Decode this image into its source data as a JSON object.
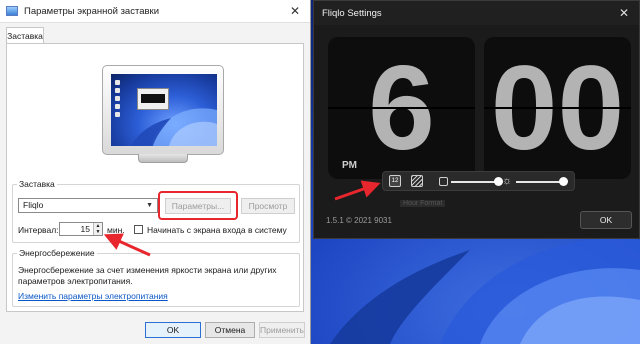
{
  "screensaver_dialog": {
    "title": "Параметры экранной заставки",
    "close_glyph": "✕",
    "tab_label": "Заставка",
    "screensaver_group": {
      "legend": "Заставка",
      "selected": "Fliqlo",
      "settings_button": "Параметры...",
      "preview_button": "Просмотр",
      "interval_label": "Интервал:",
      "interval_value": "15",
      "interval_unit": "мин.",
      "logon_checkbox_label": "Начинать с экрана входа в систему",
      "logon_checked": false
    },
    "power_group": {
      "legend": "Энергосбережение",
      "description": "Энергосбережение за счет изменения яркости экрана или других параметров электропитания.",
      "link": "Изменить параметры электропитания"
    },
    "footer": {
      "ok": "OK",
      "cancel": "Отмена",
      "apply": "Применить"
    }
  },
  "fliqlo_window": {
    "title": "Fliqlo Settings",
    "close_glyph": "✕",
    "hours": "6",
    "minutes": "00",
    "ampm": "PM",
    "format_button": "12",
    "tooltip": "Hour Format",
    "version": "1.5.1 © 2021 9031",
    "ok": "OK",
    "size_slider_level": 1.0,
    "brightness_slider_level": 1.0
  },
  "colors": {
    "annotation_red": "#e8262d",
    "dialog_bg": "#f3f3f3",
    "fliqlo_bg": "#1b1b1b",
    "digit_color": "#b3b3b3"
  },
  "icons": [
    "close-icon",
    "screensaver-app-icon",
    "dropdown-chevron-icon",
    "spinner-up-icon",
    "spinner-down-icon",
    "hour-format-icon",
    "background-toggle-icon",
    "size-icon",
    "brightness-icon"
  ]
}
